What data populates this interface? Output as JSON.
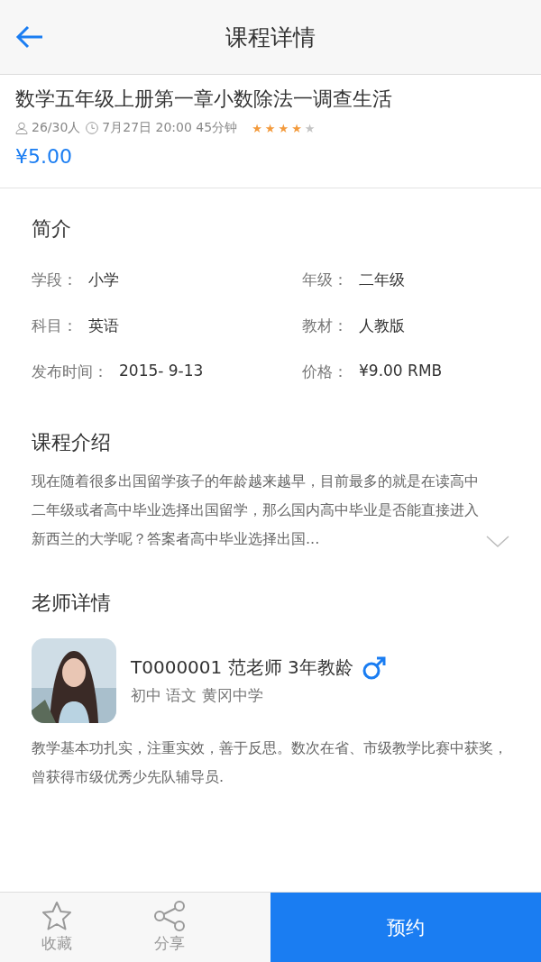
{
  "header": {
    "title": "课程详情"
  },
  "course": {
    "title": "数学五年级上册第一章小数除法一调查生活",
    "enrollment": "26/30人",
    "schedule": "7月27日 20:00 45分钟",
    "stars": 4,
    "price": "¥5.00"
  },
  "intro": {
    "heading": "简介",
    "fields": [
      {
        "label": "学段：",
        "value": "小学"
      },
      {
        "label": "年级：",
        "value": "二年级"
      },
      {
        "label": "科目：",
        "value": "英语"
      },
      {
        "label": "教材：",
        "value": "人教版"
      },
      {
        "label": "发布时间：",
        "value": "2015- 9-13"
      },
      {
        "label": "价格：",
        "value": "¥9.00 RMB"
      }
    ]
  },
  "description": {
    "heading": "课程介绍",
    "text": "现在随着很多出国留学孩子的年龄越来越早，目前最多的就是在读高中二年级或者高中毕业选择出国留学，那么国内高中毕业是否能直接进入新西兰的大学呢？答案者高中毕业选择出国...",
    "expanded": false
  },
  "teacher": {
    "heading": "老师详情",
    "name": "T0000001 范老师 3年教龄",
    "details": "初中 语文 黄冈中学",
    "bio": "教学基本功扎实，注重实效，善于反思。数次在省、市级教学比赛中获奖，曾获得市级优秀少先队辅导员."
  },
  "bottom_bar": {
    "actions": [
      {
        "kind": "star",
        "label": "收藏"
      },
      {
        "kind": "share",
        "label": "分享"
      }
    ],
    "primary": "预约"
  }
}
